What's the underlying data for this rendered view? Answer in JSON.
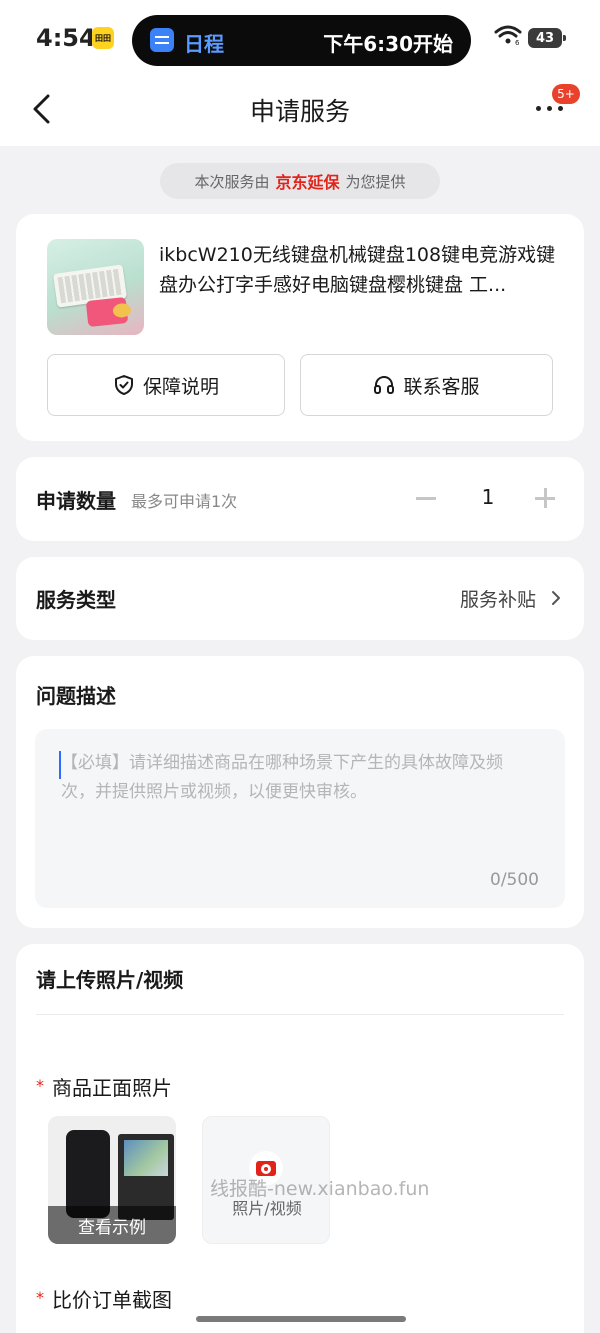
{
  "status_bar": {
    "time": "4:54",
    "notification_badge": "田田",
    "island_app": "日程",
    "island_event": "下午6:30开始",
    "wifi_level": "6",
    "battery": "43"
  },
  "nav": {
    "title": "申请服务",
    "more_badge": "5+"
  },
  "provider": {
    "prefix": "本次服务由",
    "brand": "京东延保",
    "suffix": "为您提供"
  },
  "product": {
    "title": "ikbcW210无线键盘机械键盘108键电竞游戏键盘办公打字手感好电脑键盘樱桃键盘 工...",
    "guarantee_label": "保障说明",
    "contact_label": "联系客服"
  },
  "quantity": {
    "label": "申请数量",
    "hint": "最多可申请1次",
    "value": "1"
  },
  "service_type": {
    "label": "服务类型",
    "value": "服务补贴"
  },
  "description": {
    "label": "问题描述",
    "placeholder": "【必填】请详细描述商品在哪种场景下产生的具体故障及频次，并提供照片或视频，以便更快审核。",
    "counter": "0/500"
  },
  "upload": {
    "title": "请上传照片/视频",
    "required_mark": "*",
    "front_photo_label": "商品正面照片",
    "sample_label": "查看示例",
    "add_media_label": "照片/视频",
    "compare_label": "比价订单截图"
  },
  "watermark": "线报酷-new.xianbao.fun",
  "colors": {
    "brand_red": "#e2231a",
    "page_bg": "#f2f2f4",
    "accent_blue": "#3b82f6"
  }
}
